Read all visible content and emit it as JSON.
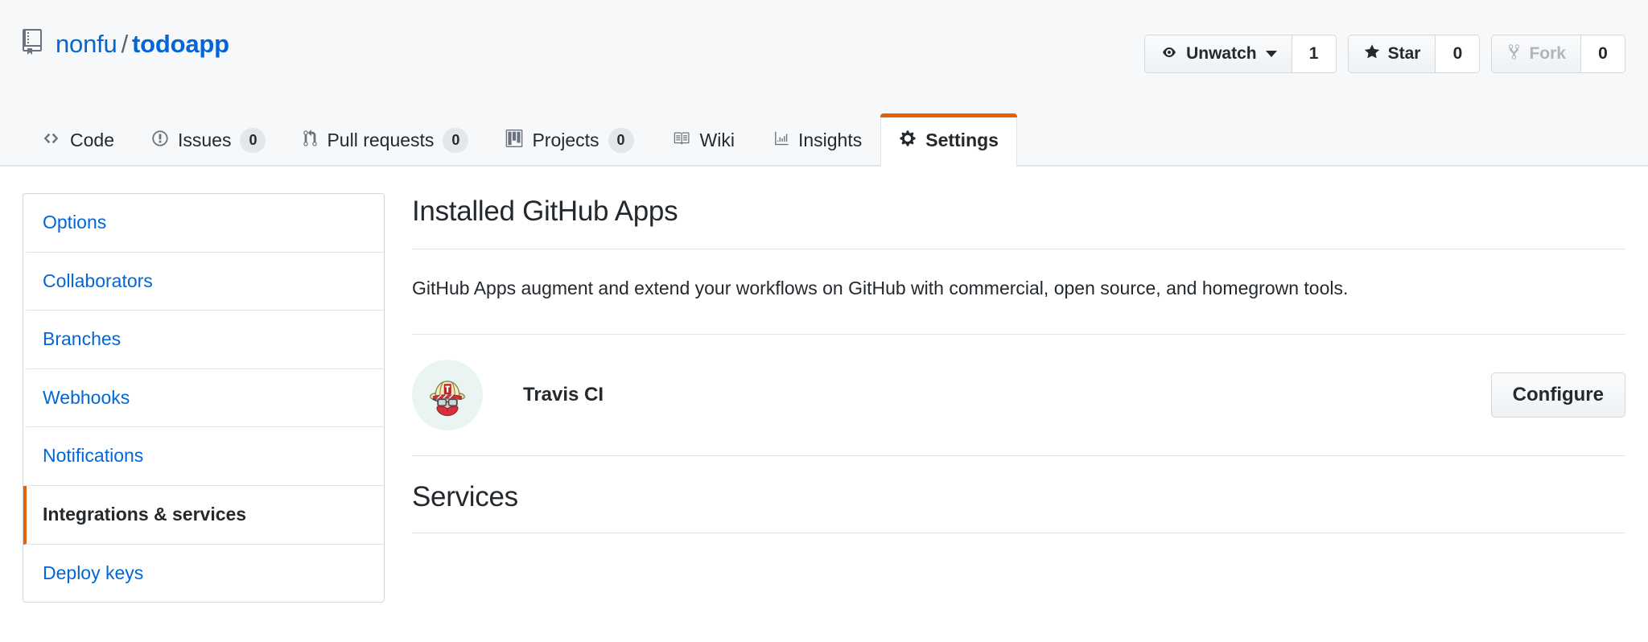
{
  "repo": {
    "icon": "repo-icon",
    "owner": "nonfu",
    "separator": "/",
    "name": "todoapp"
  },
  "actions": [
    {
      "icon": "eye-icon",
      "label": "Unwatch",
      "count": "1",
      "has_caret": true,
      "disabled": false
    },
    {
      "icon": "star-icon",
      "label": "Star",
      "count": "0",
      "has_caret": false,
      "disabled": false
    },
    {
      "icon": "fork-icon",
      "label": "Fork",
      "count": "0",
      "has_caret": false,
      "disabled": true
    }
  ],
  "nav": [
    {
      "icon": "code-icon",
      "label": "Code",
      "count": null,
      "selected": false
    },
    {
      "icon": "issue-icon",
      "label": "Issues",
      "count": "0",
      "selected": false
    },
    {
      "icon": "pr-icon",
      "label": "Pull requests",
      "count": "0",
      "selected": false
    },
    {
      "icon": "project-icon",
      "label": "Projects",
      "count": "0",
      "selected": false
    },
    {
      "icon": "wiki-icon",
      "label": "Wiki",
      "count": null,
      "selected": false
    },
    {
      "icon": "insights-icon",
      "label": "Insights",
      "count": null,
      "selected": false
    },
    {
      "icon": "gear-icon",
      "label": "Settings",
      "count": null,
      "selected": true
    }
  ],
  "sidebar": {
    "items": [
      {
        "label": "Options",
        "selected": false
      },
      {
        "label": "Collaborators",
        "selected": false
      },
      {
        "label": "Branches",
        "selected": false
      },
      {
        "label": "Webhooks",
        "selected": false
      },
      {
        "label": "Notifications",
        "selected": false
      },
      {
        "label": "Integrations & services",
        "selected": true
      },
      {
        "label": "Deploy keys",
        "selected": false
      }
    ]
  },
  "main": {
    "title": "Installed GitHub Apps",
    "description": "GitHub Apps augment and extend your workflows on GitHub with commercial, open source, and homegrown tools.",
    "apps": [
      {
        "avatar": "travis-ci-mascot-icon",
        "name": "Travis CI",
        "button": "Configure"
      }
    ],
    "services_title": "Services"
  },
  "colors": {
    "link": "#0366d6",
    "accent": "#e36209",
    "text": "#24292e",
    "header_bg": "#f6f8fa",
    "border": "#e1e4e8",
    "avatar_bg": "#e9f4f3"
  }
}
